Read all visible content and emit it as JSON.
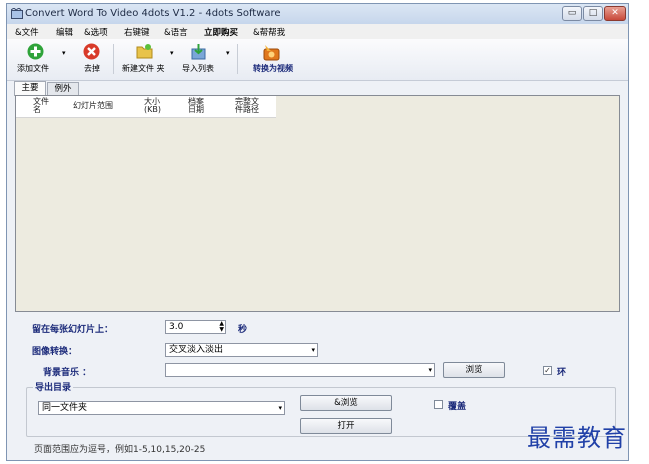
{
  "window": {
    "title": "Convert Word To Video 4dots V1.2 - 4dots Software",
    "minimize_label": "▭",
    "maximize_label": "□",
    "close_label": "✕"
  },
  "menu": [
    "&文件",
    "编辑",
    "&选项",
    "右键键",
    "&语言",
    "立即购买",
    "&帮帮我"
  ],
  "toolbar": {
    "add_file": "添加文件",
    "remove": "去掉",
    "new_folder": "新建文件 夹",
    "import_list": "导入列表",
    "convert": "转换为视频"
  },
  "tabs": [
    "主要",
    "例外"
  ],
  "file_list": {
    "columns": [
      "文件名",
      "幻灯片范围",
      "大小 (KB)",
      "档案日期",
      "完整文件路径"
    ]
  },
  "settings": {
    "stay_label": "留在每张幻灯片上：",
    "stay_value": "3.0",
    "stay_unit": "秒",
    "transition_label": "图像转换：",
    "transition_value": "交叉淡入淡出",
    "music_label": "背景音乐 ：",
    "music_value": "",
    "browse_label": "浏览",
    "loop_label": "环",
    "loop_checked": true
  },
  "output": {
    "group_label": "导出目录",
    "folder_value": "同一文件夹",
    "browse_label": "&浏览",
    "open_label": "打开",
    "overwrite_label": "覆盖",
    "overwrite_checked": false
  },
  "footer": {
    "page_range_hint": "页面范围应为逗号，例如1-5,10,15,20-25"
  },
  "watermark": "最需教育",
  "colors": {
    "label_blue": "#1b2a7a",
    "list_bg": "#edebe0"
  }
}
